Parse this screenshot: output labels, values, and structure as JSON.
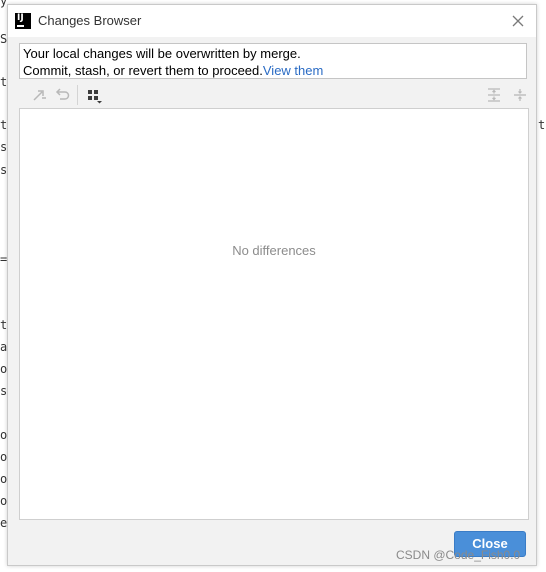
{
  "background": {
    "left_chars": [
      "y",
      "S",
      "t",
      "t",
      "s",
      "s",
      "=",
      "t",
      "a",
      "o",
      "s",
      "o",
      "o",
      "o",
      "o",
      "e"
    ],
    "right_chars": [
      "t"
    ]
  },
  "window": {
    "title": "Changes Browser",
    "app_icon_text": "IJ",
    "close_icon": "close-icon"
  },
  "banner": {
    "line1": "Your local changes will be overwritten by merge.",
    "line2": "Commit, stash, or revert them to proceed.",
    "link": "View them"
  },
  "toolbar": {
    "icons": [
      "merge-arrow-icon",
      "undo-icon",
      "group-by-icon",
      "expand-all-icon",
      "collapse-all-icon"
    ]
  },
  "panel": {
    "empty_text": "No differences"
  },
  "footer": {
    "close_label": "Close"
  },
  "watermark": "CSDN @Code_Fish0.0",
  "colors": {
    "accent": "#4a8fd9",
    "link": "#2a6bc4"
  }
}
